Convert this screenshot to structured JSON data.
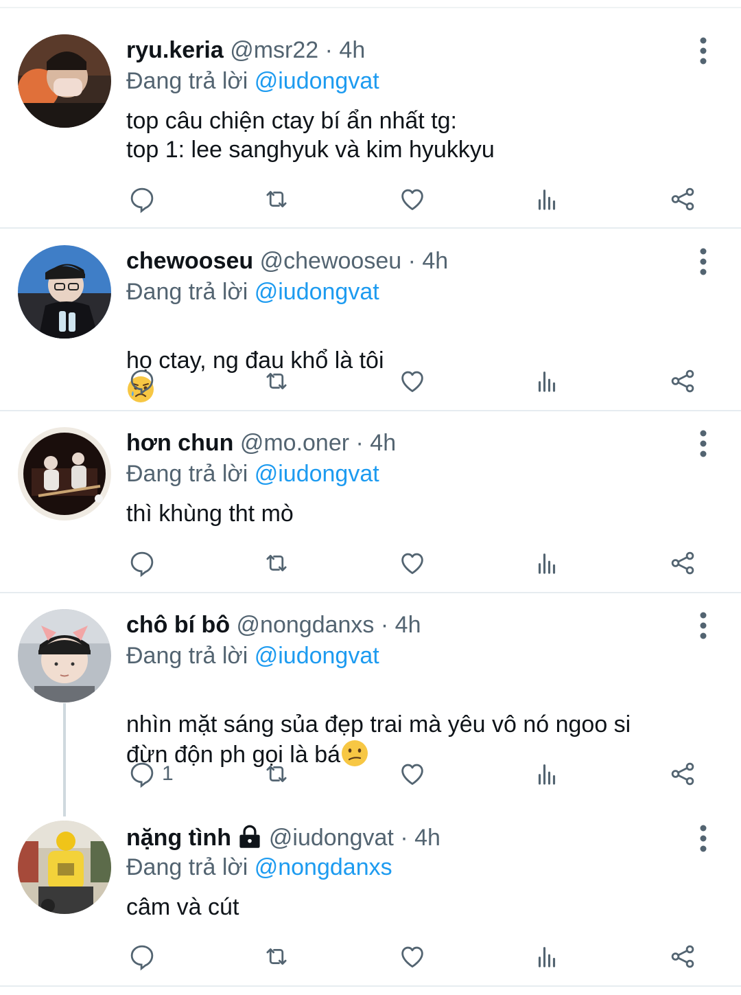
{
  "tweets": [
    {
      "name": "ryu.keria",
      "handle": "@msr22",
      "time": "· 4h",
      "replying_prefix": "Đang trả lời",
      "replying_to": "@iudongvat",
      "text": "top câu chiện ctay bí ẩn nhất tg:\ntop 1: lee sanghyuk và kim hyukkyu",
      "reply_count": ""
    },
    {
      "name": "chewooseu",
      "handle": "@chewooseu",
      "time": "· 4h",
      "replying_prefix": "Đang trả lời",
      "replying_to": "@iudongvat",
      "text": "họ ctay, ng đau khổ là tôi",
      "emoji": "sad-face-with-tear",
      "reply_count": ""
    },
    {
      "name": "hơn chun",
      "handle": "@mo.oner",
      "time": "· 4h",
      "replying_prefix": "Đang trả lời",
      "replying_to": "@iudongvat",
      "text": "thì khùng tht mò",
      "reply_count": ""
    },
    {
      "name": "chô bí bô",
      "handle": "@nongdanxs",
      "time": "· 4h",
      "replying_prefix": "Đang trả lời",
      "replying_to": "@iudongvat",
      "text": "nhìn mặt sáng sủa đẹp trai mà yêu vô nó ngoo si\nđừn độn ph gọi là bá",
      "emoji": "confused-face",
      "reply_count": "1"
    },
    {
      "name": "nặng tình",
      "handle": "@iudongvat",
      "time": "· 4h",
      "replying_prefix": "Đang trả lời",
      "replying_to": "@nongdanxs",
      "text": "câm và cút",
      "protected_icon": "lock-icon",
      "reply_count": ""
    }
  ],
  "icons": {
    "reply": "reply-icon",
    "retweet": "retweet-icon",
    "like": "heart-icon",
    "views": "analytics-icon",
    "share": "share-icon",
    "more": "more-vertical-icon"
  },
  "colors": {
    "accent": "#1d9bf0",
    "secondary_text": "#536471",
    "primary_text": "#0f1419",
    "divider": "#e6ecf0"
  }
}
